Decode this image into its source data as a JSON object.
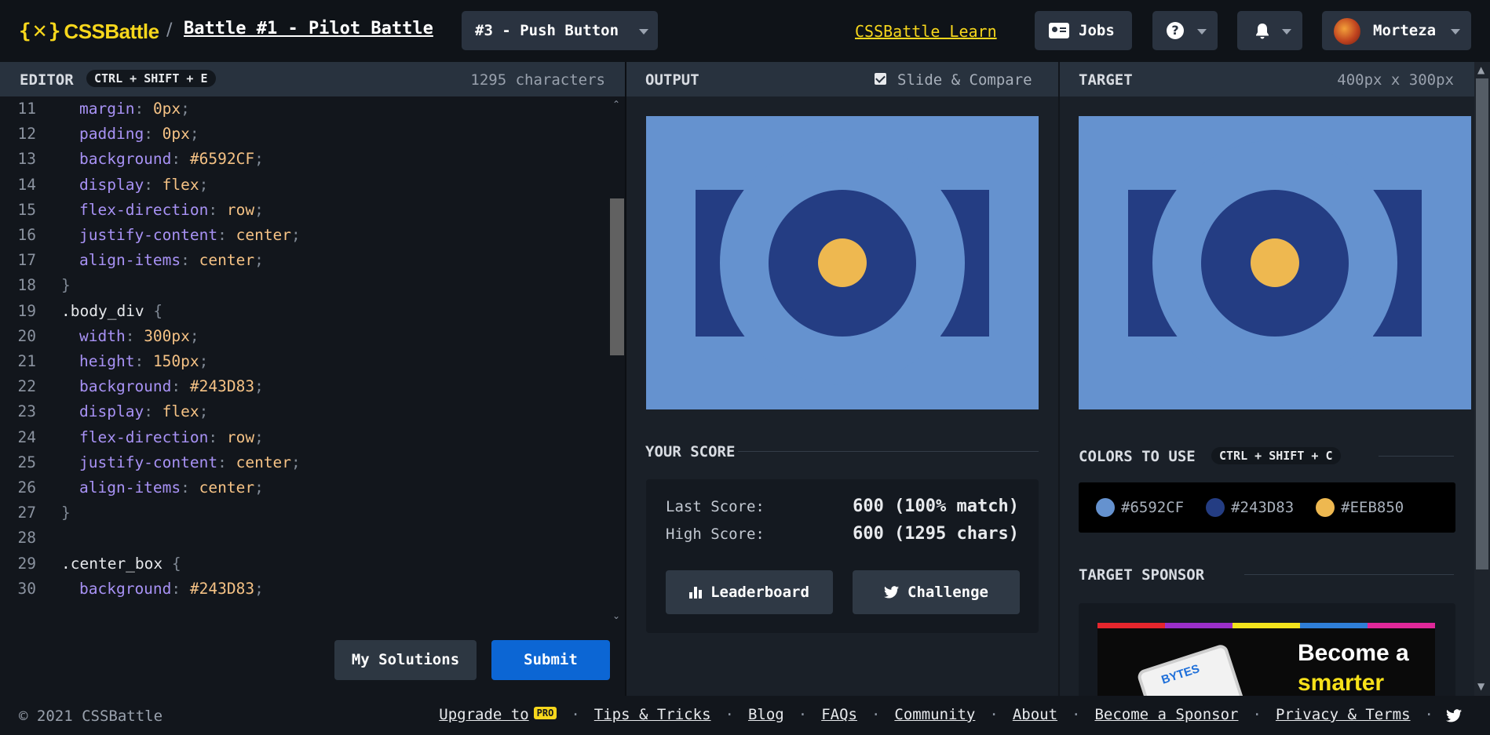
{
  "header": {
    "logo_text": "CSSBattle",
    "separator": "/",
    "battle_title": "Battle #1 - Pilot Battle",
    "target_select": "#3 - Push Button",
    "learn_link": "CSSBattle Learn",
    "jobs_label": "Jobs",
    "user_name": "Morteza"
  },
  "editor": {
    "title": "EDITOR",
    "shortcut": "CTRL + SHIFT + E",
    "char_count": "1295 characters",
    "lines": [
      {
        "n": "11",
        "parts": [
          [
            "prop",
            "margin"
          ],
          [
            "pun",
            ": "
          ],
          [
            "val",
            "0px"
          ],
          [
            "pun",
            ";"
          ]
        ],
        "indent": true
      },
      {
        "n": "12",
        "parts": [
          [
            "prop",
            "padding"
          ],
          [
            "pun",
            ": "
          ],
          [
            "val",
            "0px"
          ],
          [
            "pun",
            ";"
          ]
        ],
        "indent": true
      },
      {
        "n": "13",
        "parts": [
          [
            "prop",
            "background"
          ],
          [
            "pun",
            ": "
          ],
          [
            "val",
            "#6592CF"
          ],
          [
            "pun",
            ";"
          ]
        ],
        "indent": true
      },
      {
        "n": "14",
        "parts": [
          [
            "prop",
            "display"
          ],
          [
            "pun",
            ": "
          ],
          [
            "val",
            "flex"
          ],
          [
            "pun",
            ";"
          ]
        ],
        "indent": true
      },
      {
        "n": "15",
        "parts": [
          [
            "prop",
            "flex-direction"
          ],
          [
            "pun",
            ": "
          ],
          [
            "val",
            "row"
          ],
          [
            "pun",
            ";"
          ]
        ],
        "indent": true
      },
      {
        "n": "16",
        "parts": [
          [
            "prop",
            "justify-content"
          ],
          [
            "pun",
            ": "
          ],
          [
            "val",
            "center"
          ],
          [
            "pun",
            ";"
          ]
        ],
        "indent": true
      },
      {
        "n": "17",
        "parts": [
          [
            "prop",
            "align-items"
          ],
          [
            "pun",
            ": "
          ],
          [
            "val",
            "center"
          ],
          [
            "pun",
            ";"
          ]
        ],
        "indent": true
      },
      {
        "n": "18",
        "parts": [
          [
            "pun",
            "}"
          ]
        ],
        "indent": false
      },
      {
        "n": "19",
        "parts": [
          [
            "sel",
            ".body_div "
          ],
          [
            "pun",
            "{"
          ]
        ],
        "indent": false
      },
      {
        "n": "20",
        "parts": [
          [
            "prop",
            "width"
          ],
          [
            "pun",
            ": "
          ],
          [
            "val",
            "300px"
          ],
          [
            "pun",
            ";"
          ]
        ],
        "indent": true
      },
      {
        "n": "21",
        "parts": [
          [
            "prop",
            "height"
          ],
          [
            "pun",
            ": "
          ],
          [
            "val",
            "150px"
          ],
          [
            "pun",
            ";"
          ]
        ],
        "indent": true
      },
      {
        "n": "22",
        "parts": [
          [
            "prop",
            "background"
          ],
          [
            "pun",
            ": "
          ],
          [
            "val",
            "#243D83"
          ],
          [
            "pun",
            ";"
          ]
        ],
        "indent": true
      },
      {
        "n": "23",
        "parts": [
          [
            "prop",
            "display"
          ],
          [
            "pun",
            ": "
          ],
          [
            "val",
            "flex"
          ],
          [
            "pun",
            ";"
          ]
        ],
        "indent": true
      },
      {
        "n": "24",
        "parts": [
          [
            "prop",
            "flex-direction"
          ],
          [
            "pun",
            ": "
          ],
          [
            "val",
            "row"
          ],
          [
            "pun",
            ";"
          ]
        ],
        "indent": true
      },
      {
        "n": "25",
        "parts": [
          [
            "prop",
            "justify-content"
          ],
          [
            "pun",
            ": "
          ],
          [
            "val",
            "center"
          ],
          [
            "pun",
            ";"
          ]
        ],
        "indent": true
      },
      {
        "n": "26",
        "parts": [
          [
            "prop",
            "align-items"
          ],
          [
            "pun",
            ": "
          ],
          [
            "val",
            "center"
          ],
          [
            "pun",
            ";"
          ]
        ],
        "indent": true
      },
      {
        "n": "27",
        "parts": [
          [
            "pun",
            "}"
          ]
        ],
        "indent": false
      },
      {
        "n": "28",
        "parts": [],
        "indent": false
      },
      {
        "n": "29",
        "parts": [
          [
            "sel",
            ".center_box "
          ],
          [
            "pun",
            "{"
          ]
        ],
        "indent": false
      },
      {
        "n": "30",
        "parts": [
          [
            "prop",
            "background"
          ],
          [
            "pun",
            ": "
          ],
          [
            "val",
            "#243D83"
          ],
          [
            "pun",
            ";"
          ]
        ],
        "indent": true
      }
    ],
    "my_solutions_label": "My Solutions",
    "submit_label": "Submit"
  },
  "output": {
    "title": "OUTPUT",
    "compare_label": "Slide & Compare",
    "compare_checked": true
  },
  "score": {
    "title": "YOUR SCORE",
    "last_label": "Last Score:",
    "last_value": "600 (100% match)",
    "high_label": "High Score:",
    "high_value": "600 (1295 chars)",
    "leaderboard_label": "Leaderboard",
    "challenge_label": "Challenge"
  },
  "target": {
    "title": "TARGET",
    "size": "400px x 300px",
    "colors_title": "COLORS TO USE",
    "colors_shortcut": "CTRL + SHIFT + C",
    "colors": [
      "#6592CF",
      "#243D83",
      "#EEB850"
    ],
    "sponsor_title": "TARGET SPONSOR",
    "ad_brand": "BYTES",
    "ad_line1": "Become a",
    "ad_line2": "smarter"
  },
  "footer": {
    "copyright": "© 2021 CSSBattle",
    "links": [
      "Upgrade to",
      "Tips & Tricks",
      "Blog",
      "FAQs",
      "Community",
      "About",
      "Become a Sponsor",
      "Privacy & Terms"
    ],
    "pro_badge": "PRO"
  }
}
